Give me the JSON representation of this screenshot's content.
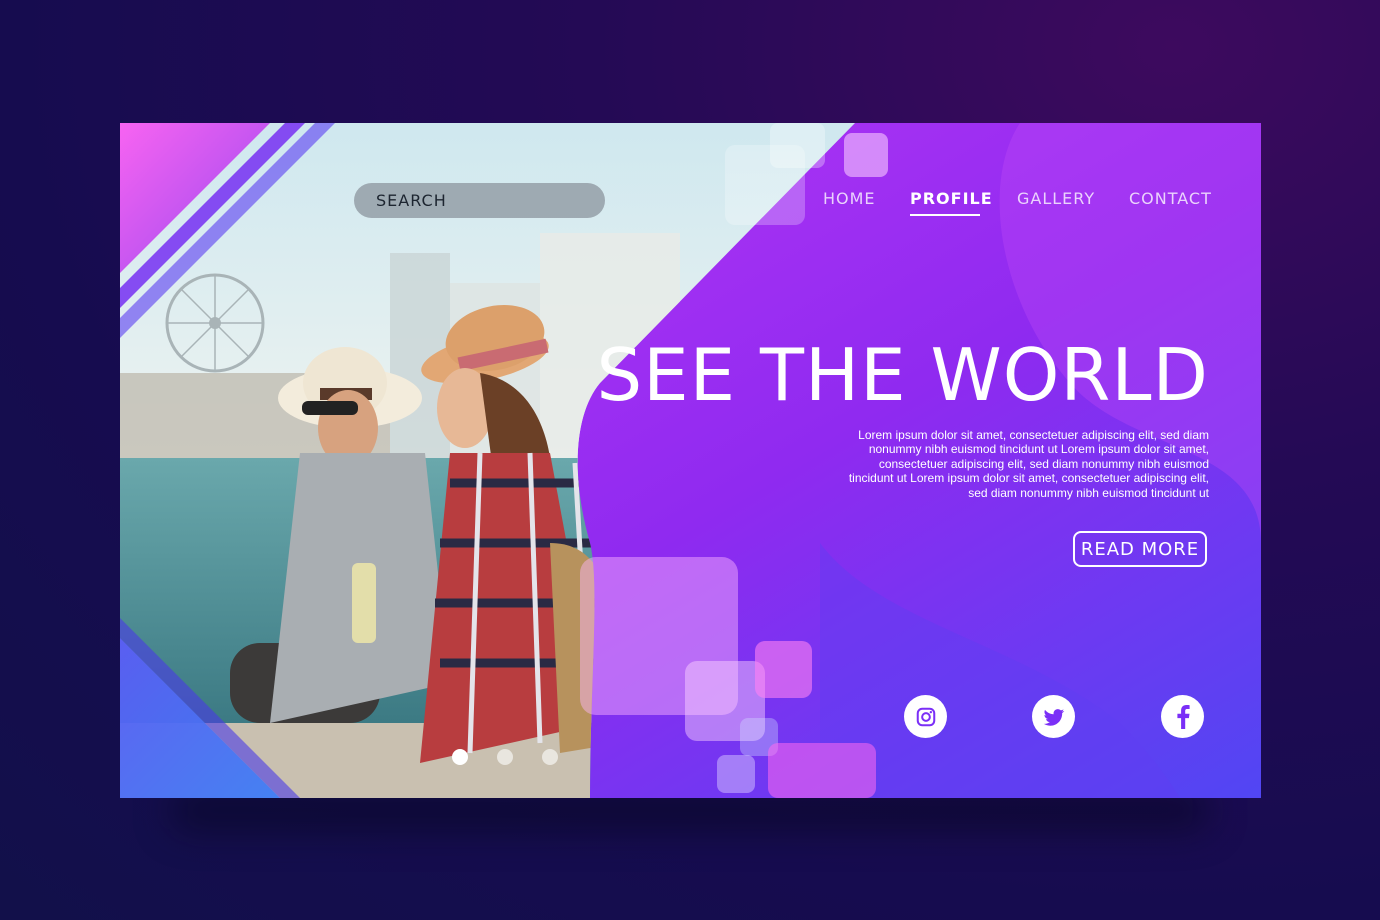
{
  "search": {
    "placeholder": "SEARCH"
  },
  "nav": {
    "items": [
      "HOME",
      "PROFILE",
      "GALLERY",
      "CONTACT"
    ],
    "active": "PROFILE"
  },
  "hero": {
    "headline": "SEE THE WORLD",
    "body": "Lorem ipsum dolor sit amet, consectetuer adipiscing elit, sed diam nonummy nibh euismod tincidunt ut Lorem ipsum dolor sit amet, consectetuer adipiscing elit, sed diam nonummy nibh euismod tincidunt ut Lorem ipsum dolor sit amet, consectetuer adipiscing elit, sed diam nonummy nibh euismod tincidunt ut",
    "cta_label": "READ MORE"
  },
  "social": [
    "instagram-icon",
    "twitter-icon",
    "facebook-icon"
  ],
  "carousel": {
    "count": 3,
    "active_index": 0
  },
  "colors": {
    "accent_pink": "#b01cf6",
    "accent_purple": "#7f2cf0",
    "accent_blue": "#5a3cf2",
    "social_icon": "#7b2ff7"
  }
}
